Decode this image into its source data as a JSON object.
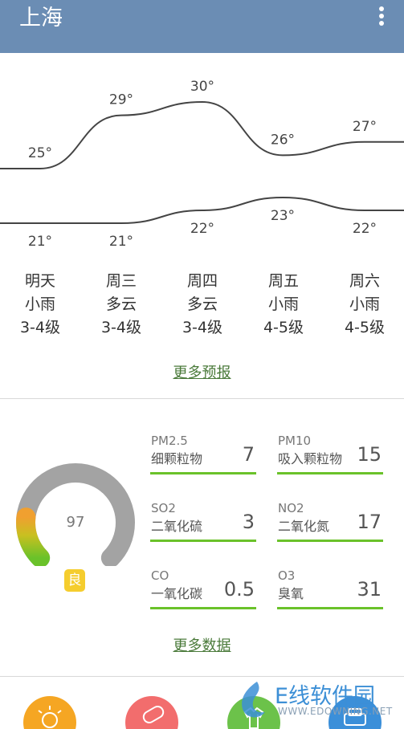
{
  "header": {
    "city": "上海",
    "menu_icon": "more-vert-icon"
  },
  "forecast": {
    "highs": [
      25,
      29,
      30,
      26,
      27
    ],
    "lows": [
      21,
      21,
      22,
      23,
      22
    ],
    "high_labels": [
      "25°",
      "29°",
      "30°",
      "26°",
      "27°"
    ],
    "low_labels": [
      "21°",
      "21°",
      "22°",
      "23°",
      "22°"
    ],
    "days": [
      {
        "day": "明天",
        "weather": "小雨",
        "wind": "3-4级"
      },
      {
        "day": "周三",
        "weather": "多云",
        "wind": "3-4级"
      },
      {
        "day": "周四",
        "weather": "多云",
        "wind": "3-4级"
      },
      {
        "day": "周五",
        "weather": "小雨",
        "wind": "4-5级"
      },
      {
        "day": "周六",
        "weather": "小雨",
        "wind": "4-5级"
      }
    ],
    "more_label": "更多预报"
  },
  "air": {
    "aqi": "97",
    "aqi_fraction": 0.19,
    "level": "良",
    "metrics": [
      {
        "name": "PM2.5",
        "sub": "细颗粒物",
        "value": "7"
      },
      {
        "name": "PM10",
        "sub": "吸入颗粒物",
        "value": "15"
      },
      {
        "name": "SO2",
        "sub": "二氧化硫",
        "value": "3"
      },
      {
        "name": "NO2",
        "sub": "二氧化氮",
        "value": "17"
      },
      {
        "name": "CO",
        "sub": "一氧化碳",
        "value": "0.5"
      },
      {
        "name": "O3",
        "sub": "臭氧",
        "value": "31"
      }
    ],
    "more_label": "更多数据"
  },
  "bottom": {
    "icons": [
      "sun-icon",
      "pill-icon",
      "shirt-icon",
      "car-icon"
    ],
    "colors": [
      "#f5a623",
      "#f26d6d",
      "#6cc24a",
      "#3b8fd9"
    ]
  },
  "watermark": {
    "title": "E线软件园",
    "url": "WWW.EDOWNING.NET"
  },
  "colors": {
    "header": "#6b8db4",
    "good_line": "#6ac22a",
    "badge": "#f5cd2e"
  }
}
